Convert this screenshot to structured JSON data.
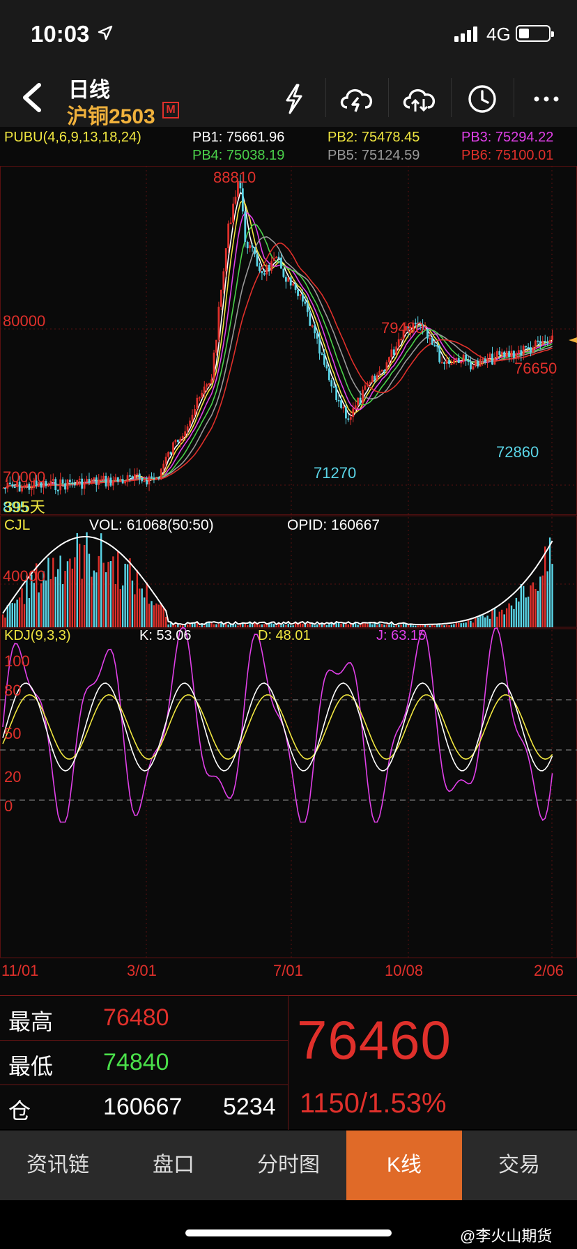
{
  "status": {
    "time": "10:03",
    "network": "4G"
  },
  "nav": {
    "title": "日线",
    "symbol": "沪铜2503",
    "badge": "M"
  },
  "indicators": {
    "pubu_label": "PUBU(4,6,9,13,18,24)",
    "pb1": "PB1: 75661.96",
    "pb2": "PB2: 75478.45",
    "pb3": "PB3: 75294.22",
    "pb4": "PB4: 75038.19",
    "pb5": "PB5: 75124.59",
    "pb6": "PB6: 75100.01"
  },
  "colors": {
    "up": "#e0302b",
    "down": "#5ad4e6",
    "pb1": "#ffffff",
    "pb2": "#f0e640",
    "pb3": "#e040e8",
    "pb4": "#4ad04a",
    "pb5": "#999999",
    "pb6": "#e0302b",
    "accent": "#e06a28"
  },
  "price_chart": {
    "y_labels": [
      "80000",
      "70000"
    ],
    "annotations": {
      "high": "88810",
      "peak2": "79480",
      "peak3": "76650",
      "low1": "71270",
      "low2": "72860"
    },
    "days_label": "395天",
    "days_label_overlap": "895"
  },
  "volume_chart": {
    "label": "CJL",
    "vol": "VOL: 61068(50:50)",
    "opid": "OPID: 160667",
    "y_label": "40000"
  },
  "kdj_chart": {
    "label": "KDJ(9,3,3)",
    "k": "K: 53.06",
    "d": "D: 48.01",
    "j": "J: 63.15",
    "y_labels": [
      "100",
      "80",
      "50",
      "20",
      "0"
    ]
  },
  "x_axis": [
    "11/01",
    "3/01",
    "7/01",
    "10/08",
    "2/06"
  ],
  "quote": {
    "high_label": "最高",
    "high": "76480",
    "low_label": "最低",
    "low": "74840",
    "oi_label": "仓",
    "oi": "160667",
    "oi_change": "5234",
    "last": "76460",
    "change": "1150/1.53%"
  },
  "tabs": [
    "资讯链",
    "盘口",
    "分时图",
    "K线",
    "交易"
  ],
  "watermark": "@李火山期货"
}
